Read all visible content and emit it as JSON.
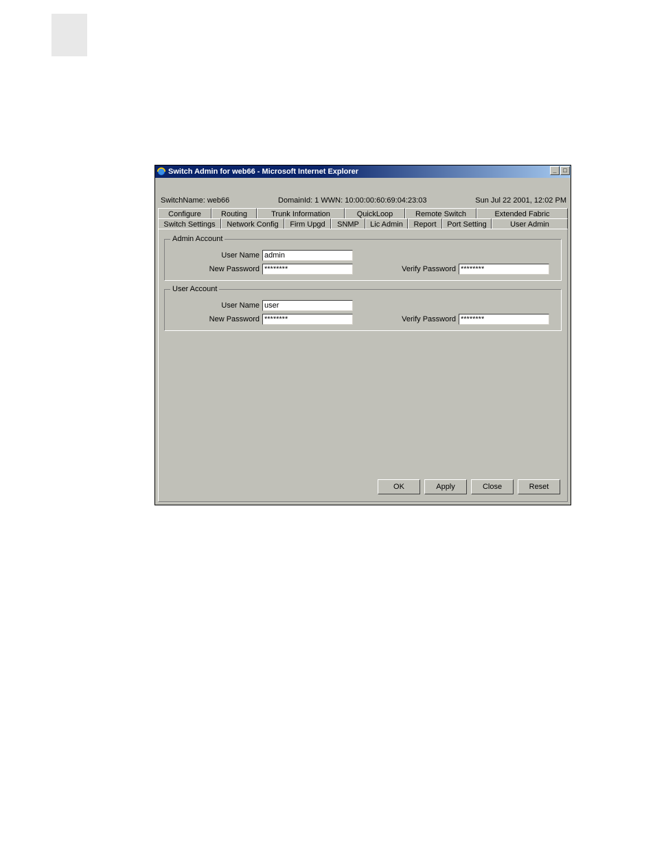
{
  "window": {
    "title": "Switch Admin for web66 - Microsoft Internet Explorer",
    "minimize_symbol": "_",
    "maximize_symbol": "□"
  },
  "header": {
    "switch_name_label": "SwitchName: web66",
    "domain_wwn_label": "DomainId: 1 WWN: 10:00:00:60:69:04:23:03",
    "timestamp": "Sun Jul 22  2001, 12:02 PM"
  },
  "tabs_row1": [
    "Configure",
    "Routing",
    "Trunk Information",
    "QuickLoop",
    "Remote Switch",
    "Extended Fabric"
  ],
  "tabs_row2": [
    "Switch Settings",
    "Network Config",
    "Firm Upgd",
    "SNMP",
    "Lic Admin",
    "Report",
    "Port Setting",
    "User Admin"
  ],
  "active_tab": "User Admin",
  "admin_account": {
    "legend": "Admin Account",
    "user_name_label": "User Name",
    "user_name_value": "admin",
    "new_password_label": "New Password",
    "new_password_value": "********",
    "verify_password_label": "Verify Password",
    "verify_password_value": "********"
  },
  "user_account": {
    "legend": "User Account",
    "user_name_label": "User Name",
    "user_name_value": "user",
    "new_password_label": "New Password",
    "new_password_value": "********",
    "verify_password_label": "Verify Password",
    "verify_password_value": "********"
  },
  "buttons": {
    "ok": "OK",
    "apply": "Apply",
    "close": "Close",
    "reset": "Reset"
  }
}
